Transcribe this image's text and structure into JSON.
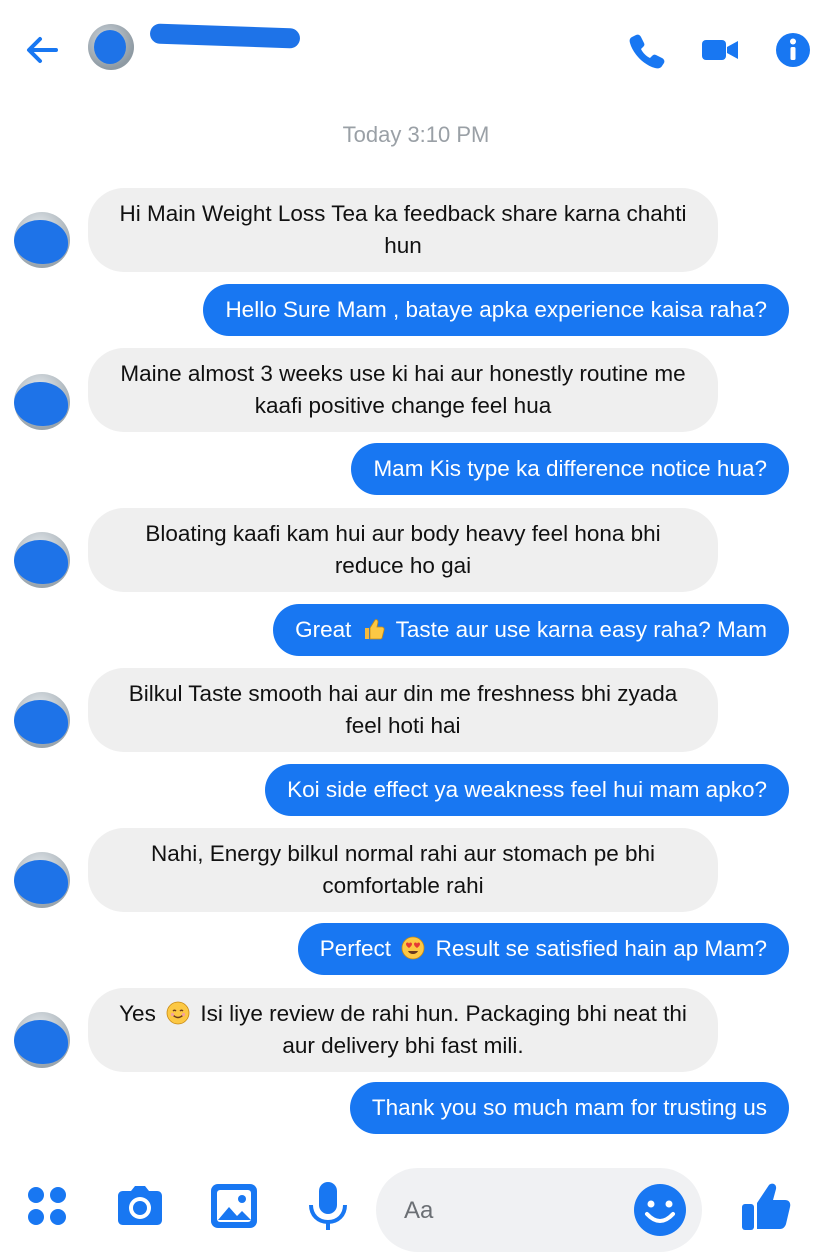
{
  "header": {
    "back_icon": "back-arrow-icon",
    "call_icon": "phone-icon",
    "video_icon": "video-camera-icon",
    "info_icon": "info-icon",
    "accent": "#1877f2"
  },
  "timestamp": "Today 3:10 PM",
  "messages": [
    {
      "from": "them",
      "text": "Hi Main Weight Loss Tea ka feedback share karna chahti hun"
    },
    {
      "from": "me",
      "text": "Hello Sure Mam , bataye apka experience kaisa raha?"
    },
    {
      "from": "them",
      "text": "Maine almost 3 weeks use ki hai aur honestly routine me kaafi positive change feel hua"
    },
    {
      "from": "me",
      "text": "Mam Kis type ka difference notice hua?"
    },
    {
      "from": "them",
      "text": "Bloating kaafi kam hui aur body heavy feel hona bhi reduce ho gai"
    },
    {
      "from": "me",
      "text_before": "Great",
      "emoji": "thumbs-up-emoji",
      "text_after": "Taste aur use karna easy raha? Mam"
    },
    {
      "from": "them",
      "text": "Bilkul Taste smooth hai aur din me freshness bhi zyada feel hoti hai"
    },
    {
      "from": "me",
      "text": "Koi side effect ya weakness feel hui mam apko?"
    },
    {
      "from": "them",
      "text": "Nahi, Energy bilkul normal rahi aur stomach pe bhi comfortable rahi"
    },
    {
      "from": "me",
      "text_before": "Perfect",
      "emoji": "heart-eyes-emoji",
      "text_after": "Result se satisfied hain ap Mam?"
    },
    {
      "from": "them",
      "text_before": "Yes",
      "emoji": "smiling-emoji",
      "text_after": "Isi liye review de rahi hun. Packaging bhi neat thi aur delivery bhi fast mili."
    },
    {
      "from": "me",
      "text": "Thank you so much mam for trusting us"
    }
  ],
  "composer": {
    "placeholder": "Aa",
    "icons": [
      "apps-grid-icon",
      "camera-icon",
      "image-icon",
      "microphone-icon",
      "emoji-icon",
      "like-thumb-icon"
    ]
  }
}
